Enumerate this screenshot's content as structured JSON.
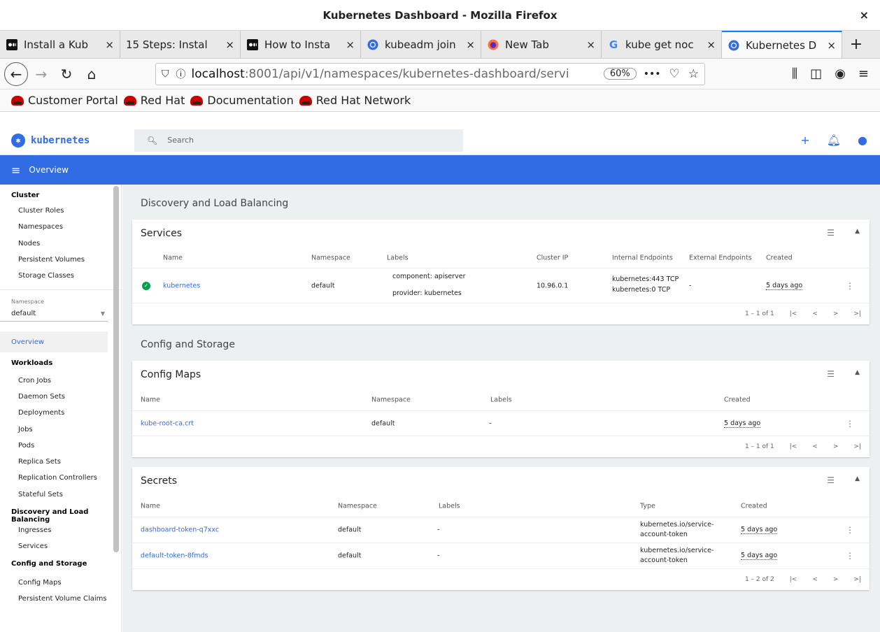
{
  "window": {
    "title": "Kubernetes Dashboard - Mozilla Firefox",
    "close_glyph": "×"
  },
  "tabs": [
    {
      "label": "Install a Kub",
      "icon": "medium-icon"
    },
    {
      "label": "15 Steps: Instal",
      "icon": "none"
    },
    {
      "label": "How to Insta",
      "icon": "medium-icon"
    },
    {
      "label": "kubeadm join",
      "icon": "kubernetes-icon"
    },
    {
      "label": "New Tab",
      "icon": "firefox-icon"
    },
    {
      "label": "kube get noc",
      "icon": "google-icon"
    },
    {
      "label": "Kubernetes D",
      "icon": "kubernetes-icon",
      "active": true
    }
  ],
  "tab_close_glyph": "×",
  "new_tab_glyph": "+",
  "nav": {
    "url_host": "localhost",
    "url_path": ":8001/api/v1/namespaces/kubernetes-dashboard/servi",
    "zoom": "60%",
    "more": "•••"
  },
  "bookmarks": [
    "Customer Portal",
    "Red Hat",
    "Documentation",
    "Red Hat Network"
  ],
  "dashboard": {
    "brand": "kubernetes",
    "search_placeholder": "Search",
    "toolbar_title": "Overview"
  },
  "sidebar": {
    "cluster_head": "Cluster",
    "cluster_items": [
      "Cluster Roles",
      "Namespaces",
      "Nodes",
      "Persistent Volumes",
      "Storage Classes"
    ],
    "namespace_label": "Namespace",
    "namespace_value": "default",
    "overview": "Overview",
    "workloads_head": "Workloads",
    "workload_items": [
      "Cron Jobs",
      "Daemon Sets",
      "Deployments",
      "Jobs",
      "Pods",
      "Replica Sets",
      "Replication Controllers",
      "Stateful Sets"
    ],
    "discovery_head": "Discovery and Load Balancing",
    "discovery_items": [
      "Ingresses",
      "Services"
    ],
    "config_head": "Config and Storage",
    "config_items": [
      "Config Maps",
      "Persistent Volume Claims"
    ]
  },
  "content": {
    "discovery_title": "Discovery and Load Balancing",
    "services": {
      "title": "Services",
      "headers": [
        "Name",
        "Namespace",
        "Labels",
        "Cluster IP",
        "Internal Endpoints",
        "External Endpoints",
        "Created"
      ],
      "row": {
        "name": "kubernetes",
        "namespace": "default",
        "label1": "component: apiserver",
        "label2": "provider: kubernetes",
        "cluster_ip": "10.96.0.1",
        "endpoint1": "kubernetes:443 TCP",
        "endpoint2": "kubernetes:0 TCP",
        "external": "-",
        "created": "5 days ago"
      },
      "pager": "1 – 1 of 1"
    },
    "config_title": "Config and Storage",
    "configmaps": {
      "title": "Config Maps",
      "headers": [
        "Name",
        "Namespace",
        "Labels",
        "Created"
      ],
      "row": {
        "name": "kube-root-ca.crt",
        "namespace": "default",
        "labels": "-",
        "created": "5 days ago"
      },
      "pager": "1 – 1 of 1"
    },
    "secrets": {
      "title": "Secrets",
      "headers": [
        "Name",
        "Namespace",
        "Labels",
        "Type",
        "Created"
      ],
      "rows": [
        {
          "name": "dashboard-token-q7xxc",
          "namespace": "default",
          "labels": "-",
          "type1": "kubernetes.io/service-",
          "type2": "account-token",
          "created": "5 days ago"
        },
        {
          "name": "default-token-8fmds",
          "namespace": "default",
          "labels": "-",
          "type1": "kubernetes.io/service-",
          "type2": "account-token",
          "created": "5 days ago"
        }
      ],
      "pager": "1 – 2 of 2"
    },
    "pager_glyphs": {
      "first": "|<",
      "prev": "<",
      "next": ">",
      "last": ">|"
    }
  },
  "colors": {
    "accent": "#326ce5",
    "ok": "#00a14b",
    "content_bg": "#edf0f1"
  }
}
